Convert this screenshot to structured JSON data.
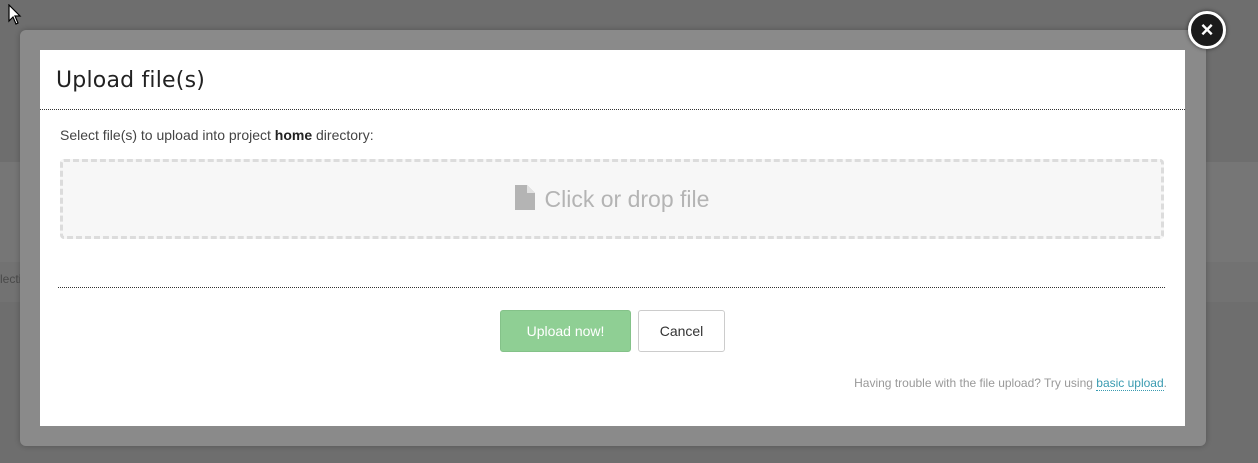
{
  "background": {
    "side_text": "lecti"
  },
  "dialog": {
    "title": "Upload file(s)",
    "prompt_prefix": "Select file(s) to upload into project ",
    "prompt_bold": "home",
    "prompt_suffix": " directory:",
    "dropzone_label": "Click or drop file",
    "dropzone_icon": "file-icon",
    "upload_button": "Upload now!",
    "cancel_button": "Cancel",
    "help_prefix": "Having trouble with the file upload? Try using ",
    "help_link": "basic upload",
    "help_suffix": ".",
    "close_symbol": "×"
  },
  "colors": {
    "upload_button_bg": "#8fcf94",
    "link": "#3a9bb1",
    "dropzone_text": "#b4b4b4"
  }
}
